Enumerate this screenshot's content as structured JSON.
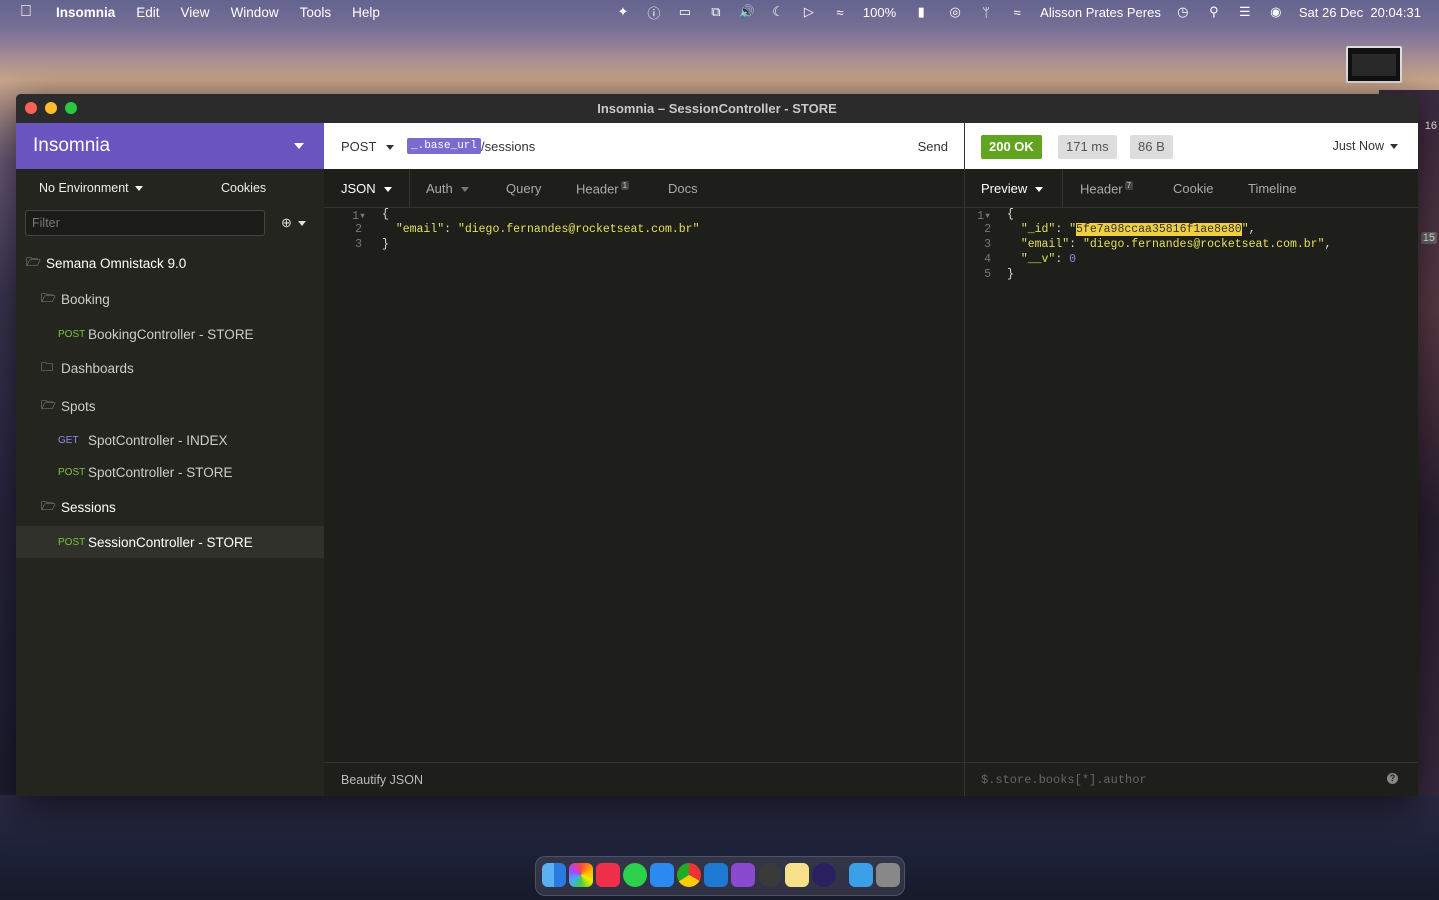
{
  "menubar": {
    "app": "Insomnia",
    "items": [
      "Edit",
      "View",
      "Window",
      "Tools",
      "Help"
    ],
    "battery": "100%",
    "user": "Alisson Prates Peres",
    "clock": "Sat 26 Dec  20:04:31"
  },
  "desktop": {
    "edge_badge_top": "16",
    "edge_badge_mid": "15"
  },
  "window": {
    "title": "Insomnia – SessionController - STORE"
  },
  "sidebar": {
    "brand": "Insomnia",
    "environment": "No Environment",
    "cookies": "Cookies",
    "filter_placeholder": "Filter",
    "workspace": "Semana Omnistack 9.0",
    "folders": {
      "booking": "Booking",
      "dashboards": "Dashboards",
      "spots": "Spots",
      "sessions": "Sessions"
    },
    "requests": {
      "booking_store": {
        "method": "POST",
        "name": "BookingController - STORE"
      },
      "spot_index": {
        "method": "GET",
        "name": "SpotController - INDEX"
      },
      "spot_store": {
        "method": "POST",
        "name": "SpotController - STORE"
      },
      "session_store": {
        "method": "POST",
        "name": "SessionController - STORE"
      }
    }
  },
  "request": {
    "method": "POST",
    "base_url_tag": "_.base_url",
    "path": "/sessions",
    "send": "Send",
    "tabs": {
      "body": "JSON",
      "auth": "Auth",
      "query": "Query",
      "header": "Header",
      "header_count": "1",
      "docs": "Docs"
    },
    "body_lines": [
      "{",
      "  \"email\": \"diego.fernandes@rocketseat.com.br\"",
      "}"
    ],
    "email_key": "\"email\"",
    "email_val": "\"diego.fernandes@rocketseat.com.br\"",
    "footer": "Beautify JSON"
  },
  "response": {
    "status": "200 OK",
    "time": "171 ms",
    "size": "86 B",
    "when": "Just Now",
    "tabs": {
      "preview": "Preview",
      "header": "Header",
      "header_count": "7",
      "cookie": "Cookie",
      "timeline": "Timeline"
    },
    "id_key": "\"_id\"",
    "id_val": "5fe7a98ccaa35816f1ae8e80",
    "email_key": "\"email\"",
    "email_val": "\"diego.fernandes@rocketseat.com.br\"",
    "v_key": "\"__v\"",
    "v_val": "0",
    "filter_placeholder": "$.store.books[*].author",
    "help": "?"
  },
  "colors": {
    "brand": "#6a55c0",
    "ok": "#61a420",
    "post": "#7cc242",
    "get": "#8c8cf0"
  }
}
